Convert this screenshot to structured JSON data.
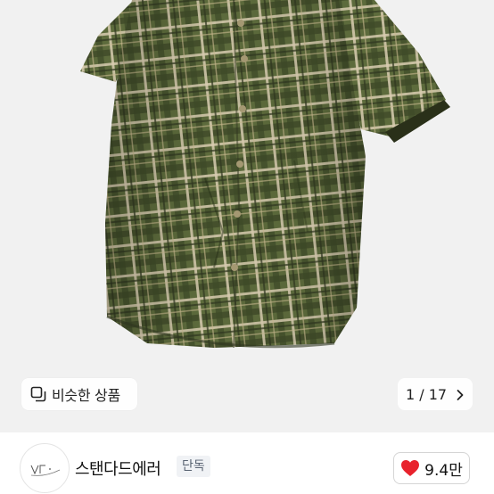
{
  "gallery": {
    "similar_button_label": "비슷한 상품",
    "pager": {
      "current": "1",
      "total": "17"
    }
  },
  "brand": {
    "name": "스탠다드에러",
    "badge": "단독",
    "likes": "9.4만"
  },
  "colors": {
    "shirt_base": "#5d6b3c",
    "check_light": "#d8cdb0",
    "check_dark": "#2f3620",
    "heart": "#e8222c"
  },
  "icons": {
    "similar": "duplicate-squares-icon",
    "pager_next": "chevron-right-icon",
    "like": "heart-icon"
  }
}
